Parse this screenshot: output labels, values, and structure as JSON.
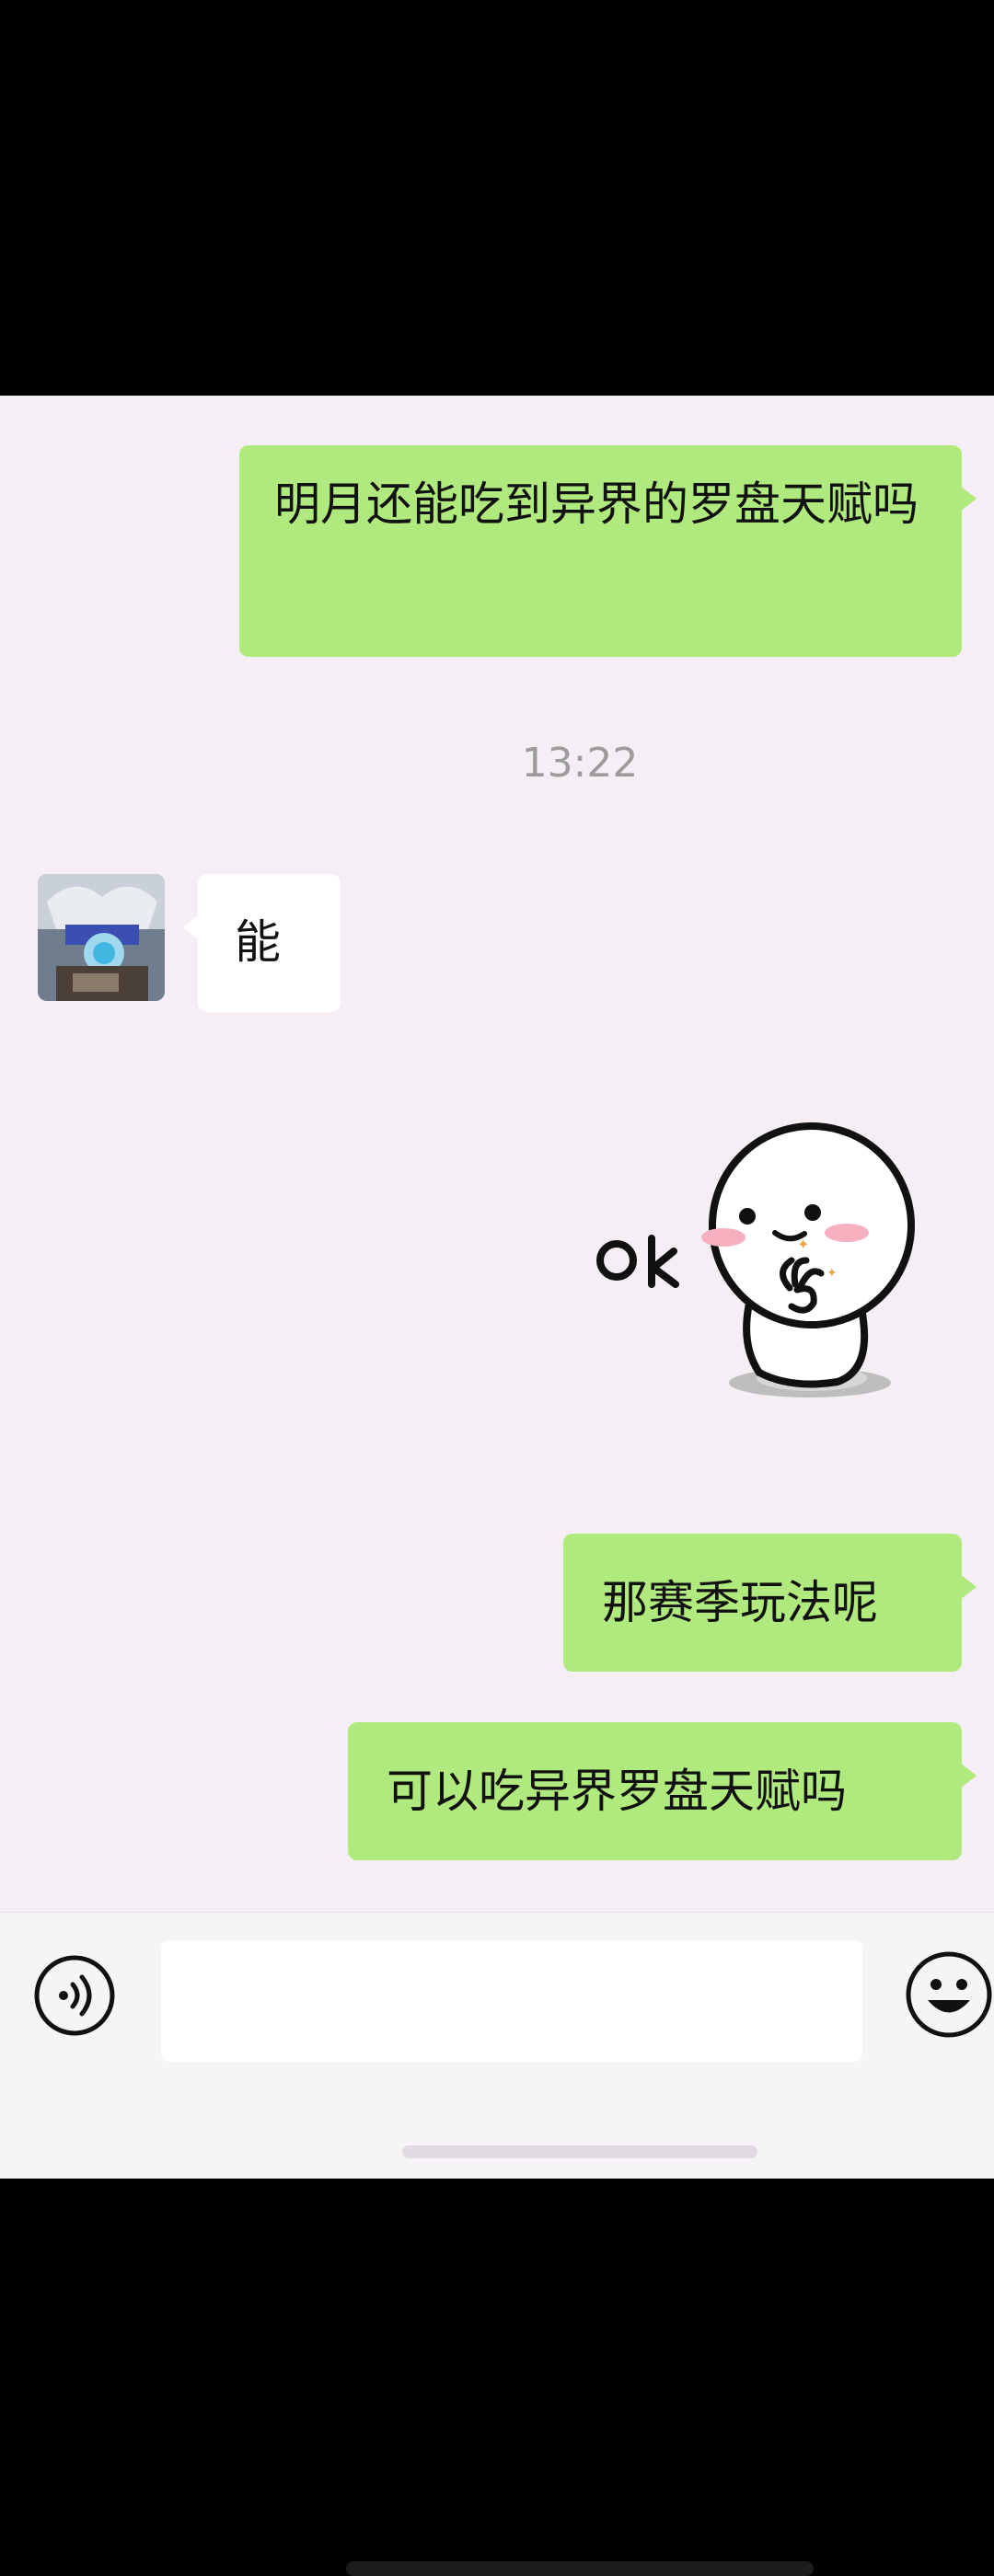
{
  "chat": {
    "messages": [
      {
        "sender": "me",
        "text": "明月还能吃到异界的罗盘天赋吗"
      },
      {
        "sender": "system",
        "text": "13:22"
      },
      {
        "sender": "them",
        "text": "能"
      },
      {
        "sender": "them",
        "sticker": "ok-sticker",
        "text": "ok"
      },
      {
        "sender": "me",
        "text": "那赛季玩法呢"
      },
      {
        "sender": "me",
        "text": "可以吃异界罗盘天赋吗"
      }
    ]
  },
  "input": {
    "placeholder": ""
  },
  "icons": {
    "voice": "voice-icon",
    "emoji": "emoji-icon"
  },
  "colors": {
    "my_bubble": "#b0e97d",
    "their_bubble": "#ffffff",
    "background": "#f5eff5",
    "timestamp": "#9c9c9c"
  }
}
